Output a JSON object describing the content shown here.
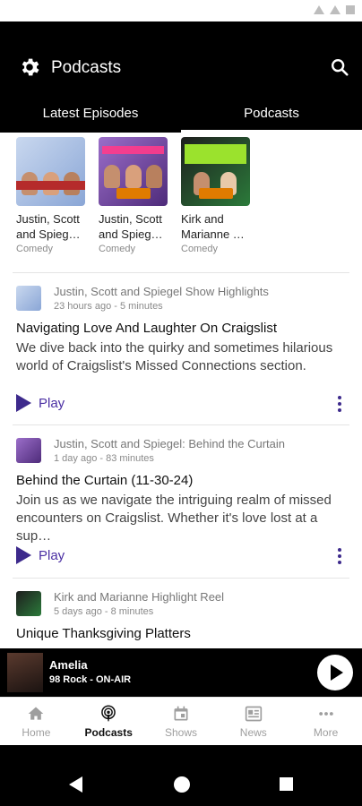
{
  "header": {
    "title": "Podcasts",
    "tabs": [
      {
        "label": "Latest Episodes",
        "active": false
      },
      {
        "label": "Podcasts",
        "active": true
      }
    ]
  },
  "followed": [
    {
      "title": "Justin, Scott and Spieg…",
      "category": "Comedy"
    },
    {
      "title": "Justin, Scott and Spieg…",
      "category": "Comedy"
    },
    {
      "title": "Kirk and Marianne …",
      "category": "Comedy"
    }
  ],
  "episodes": [
    {
      "show": "Justin, Scott and Spiegel Show Highlights",
      "time": "23 hours ago - 5 minutes",
      "title": "Navigating Love And Laughter On Craigslist",
      "description": "We dive back into the quirky and sometimes hilarious world of Craigslist's Missed Connections section.",
      "play_label": "Play"
    },
    {
      "show": "Justin, Scott and Spiegel: Behind the Curtain",
      "time": "1 day ago - 83 minutes",
      "title": "Behind the Curtain (11-30-24)",
      "description": "Join us as we navigate the intriguing realm of missed encounters on Craigslist. Whether it's love lost at a sup…",
      "play_label": "Play"
    },
    {
      "show": "Kirk and Marianne Highlight Reel",
      "time": "5 days ago - 8 minutes",
      "title": "Unique Thanksgiving Platters"
    }
  ],
  "player": {
    "name": "Amelia",
    "station": "98 Rock - ON-AIR"
  },
  "nav": [
    {
      "label": "Home",
      "icon": "home-icon",
      "active": false
    },
    {
      "label": "Podcasts",
      "icon": "podcast-icon",
      "active": true
    },
    {
      "label": "Shows",
      "icon": "calendar-icon",
      "active": false
    },
    {
      "label": "News",
      "icon": "news-icon",
      "active": false
    },
    {
      "label": "More",
      "icon": "more-icon",
      "active": false
    }
  ],
  "colors": {
    "accent": "#3d2a8c",
    "app_bar": "#000000"
  }
}
